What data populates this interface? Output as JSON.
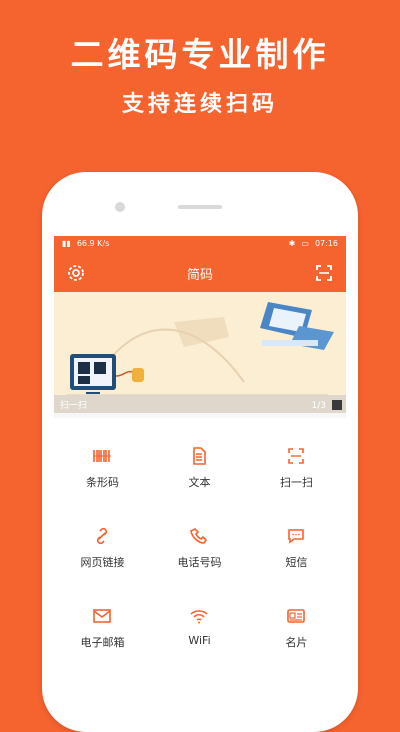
{
  "promo": {
    "headline": "二维码专业制作",
    "subline": "支持连续扫码"
  },
  "statusbar": {
    "left": "66.9 K/s",
    "time": "07:16"
  },
  "appbar": {
    "title": "简码",
    "settings_icon": "gear-icon",
    "scan_icon": "scan-icon"
  },
  "banner": {
    "caption": "扫一扫",
    "page": "1/3"
  },
  "features": [
    {
      "label": "条形码",
      "icon": "barcode-icon"
    },
    {
      "label": "文本",
      "icon": "document-icon"
    },
    {
      "label": "扫一扫",
      "icon": "scan-frame-icon"
    },
    {
      "label": "网页链接",
      "icon": "link-icon"
    },
    {
      "label": "电话号码",
      "icon": "phone-icon"
    },
    {
      "label": "短信",
      "icon": "message-icon"
    },
    {
      "label": "电子邮箱",
      "icon": "email-icon"
    },
    {
      "label": "WiFi",
      "icon": "wifi-icon"
    },
    {
      "label": "名片",
      "icon": "card-icon"
    }
  ],
  "colors": {
    "accent": "#f5632f"
  }
}
